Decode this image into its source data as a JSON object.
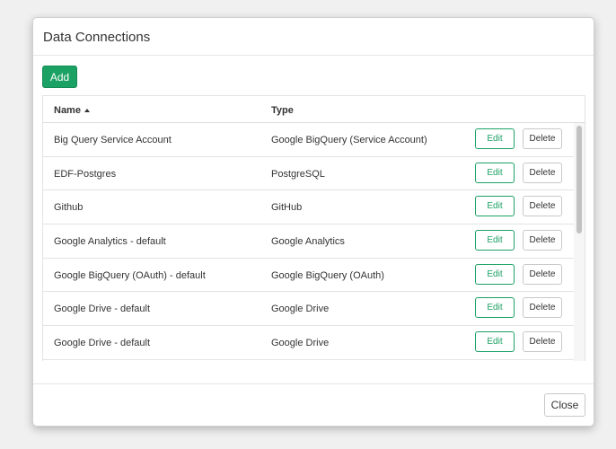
{
  "dialog": {
    "title": "Data Connections",
    "add_label": "Add",
    "close_label": "Close"
  },
  "table": {
    "columns": [
      {
        "label": "Name",
        "sort": "ascending"
      },
      {
        "label": "Type"
      }
    ],
    "edit_label": "Edit",
    "delete_label": "Delete",
    "rows": [
      {
        "name": "Big Query Service Account",
        "type": "Google BigQuery (Service Account)"
      },
      {
        "name": "EDF-Postgres",
        "type": "PostgreSQL"
      },
      {
        "name": "Github",
        "type": "GitHub"
      },
      {
        "name": "Google Analytics - default",
        "type": "Google Analytics"
      },
      {
        "name": "Google BigQuery (OAuth) - default",
        "type": "Google BigQuery (OAuth)"
      },
      {
        "name": "Google Drive - default",
        "type": "Google Drive"
      },
      {
        "name": "Google Drive - default",
        "type": "Google Drive"
      }
    ]
  },
  "colors": {
    "accent": "#1aa163",
    "border": "#e3e3e3"
  }
}
